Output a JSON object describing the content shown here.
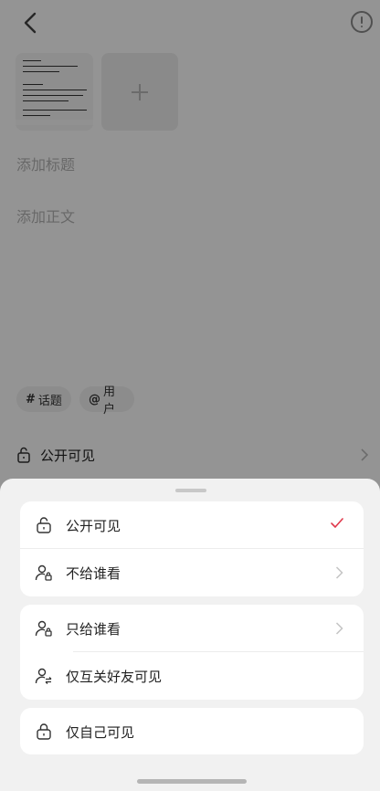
{
  "editor": {
    "title_placeholder": "添加标题",
    "body_placeholder": "添加正文",
    "chips": {
      "topic": "话题",
      "topic_symbol": "#",
      "user": "用户",
      "user_symbol": "@"
    },
    "visibility_label": "公开可见"
  },
  "sheet": {
    "options": [
      {
        "label": "公开可见",
        "icon": "lock-open-icon",
        "selected": true
      },
      {
        "label": "不给谁看",
        "icon": "user-lock-icon"
      },
      {
        "label": "只给谁看",
        "icon": "user-lock-icon"
      },
      {
        "label": "仅互关好友可见",
        "icon": "user-mutual-icon"
      },
      {
        "label": "仅自己可见",
        "icon": "lock-icon"
      }
    ],
    "accent_color": "#e0384b"
  }
}
